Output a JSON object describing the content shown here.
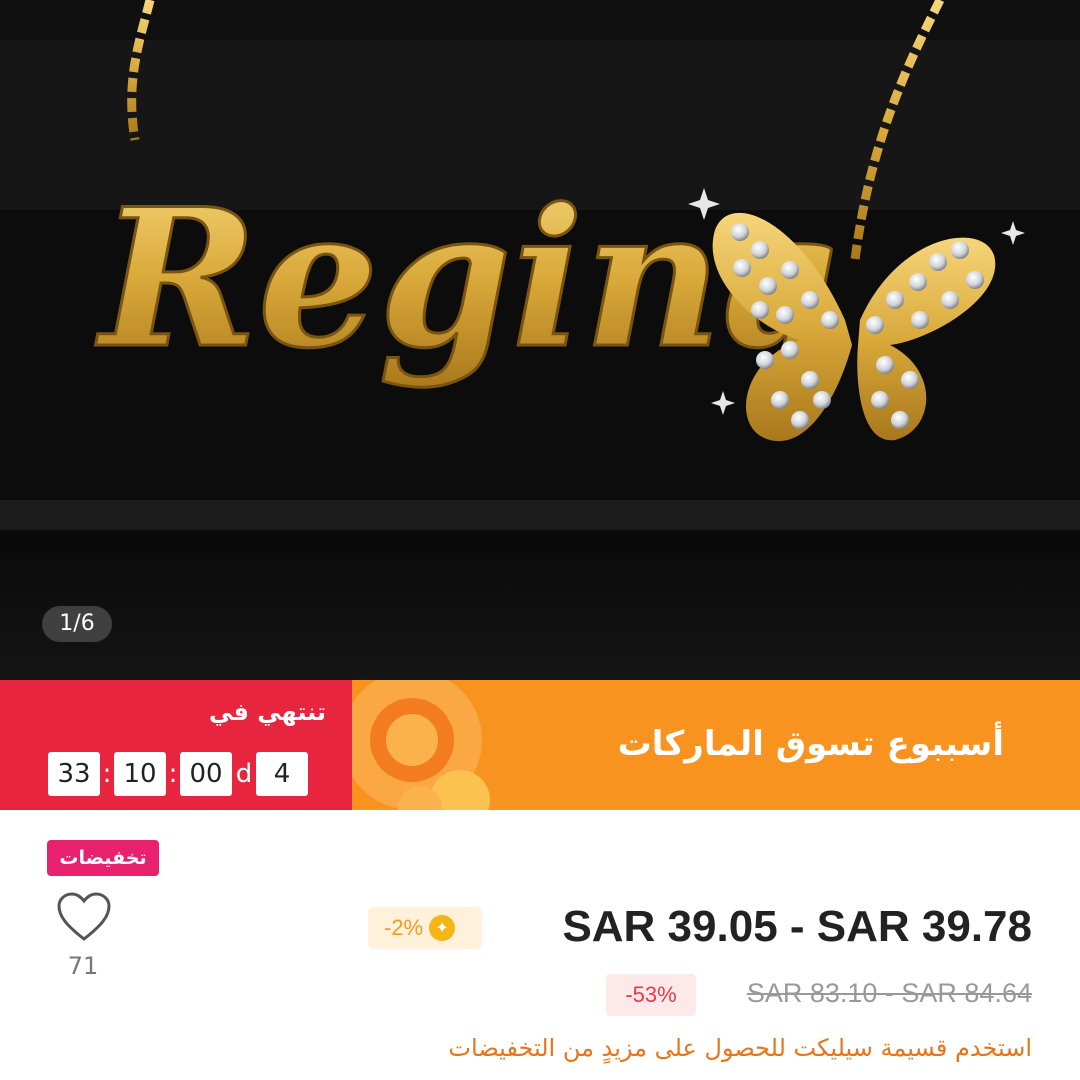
{
  "gallery": {
    "pendant_text": "Regina",
    "counter": "1/6"
  },
  "banner": {
    "title": "أسببوع تسوق الماركات",
    "ends_label": "تنتهي في",
    "countdown": {
      "days": "4",
      "day_unit": "d",
      "hours": "00",
      "minutes": "10",
      "seconds": "33",
      "separator": ":"
    },
    "colors": {
      "left": "#e8253e",
      "right": "#f7931e"
    }
  },
  "product": {
    "sale_tag": "تخفيضات",
    "likes": "71",
    "price_range": "SAR 39.05 - SAR 39.78",
    "coupon_percent": "-2%",
    "original_price_range": "SAR 83.10 - SAR 84.64",
    "discount_percent": "-53%",
    "promo_text": "استخدم قسيمة سيليكت للحصول على مزيدٍ من التخفيضات"
  },
  "icons": [
    "heart-icon",
    "coupon-star-icon"
  ]
}
